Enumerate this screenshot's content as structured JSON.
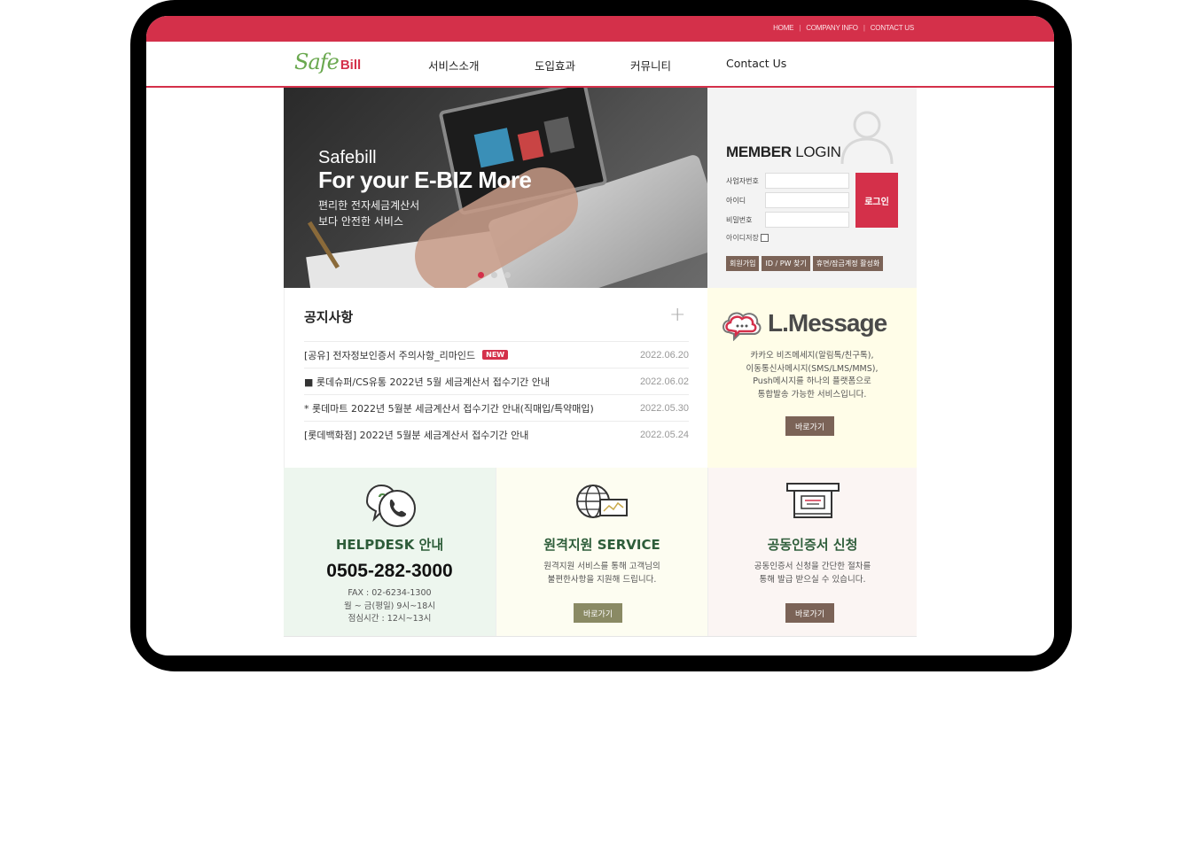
{
  "topbar": {
    "links": [
      "HOME",
      "COMPANY INFO",
      "CONTACT US"
    ]
  },
  "logo": {
    "safe": "Safe",
    "bill": "Bill"
  },
  "menu": [
    "서비스소개",
    "도입효과",
    "커뮤니티",
    "Contact Us"
  ],
  "hero": {
    "line1": "Safebill",
    "line2": "For your E-BIZ More",
    "line3": "편리한 전자세금계산서",
    "line4": "보다 안전한 서비스",
    "slides": 3,
    "active_slide": 1
  },
  "login": {
    "title_bold": "MEMBER",
    "title_rest": "LOGIN",
    "field1_label": "사업자번호",
    "field2_label": "아이디",
    "field3_label": "비밀번호",
    "login_button": "로그인",
    "save_label": "아이디저장",
    "links": [
      "회원가입",
      "ID / PW 찾기",
      "휴면/잠금계정 활성화"
    ]
  },
  "notice": {
    "title": "공지사항",
    "new_badge": "NEW",
    "items": [
      {
        "title": "[공유] 전자정보인증서 주의사항_리마인드",
        "date": "2022.06.20",
        "is_new": true
      },
      {
        "title": "■ 롯데슈퍼/CS유통 2022년 5월 세금계산서 접수기간 안내",
        "date": "2022.06.02"
      },
      {
        "title": "* 롯데마트 2022년 5월분 세금계산서 접수기간 안내(직매입/특약매입)",
        "date": "2022.05.30"
      },
      {
        "title": "[롯데백화점] 2022년 5월분 세금계산서 접수기간 안내",
        "date": "2022.05.24"
      }
    ]
  },
  "lmessage": {
    "logo_text": "L.Message",
    "desc1": "카카오 비즈메세지(알림톡/친구톡),",
    "desc2": "이동통신사메시지(SMS/LMS/MMS),",
    "desc3": "Push메시지를 하나의 플랫폼으로",
    "desc4": "통합발송 가능한 서비스입니다.",
    "button": "바로가기"
  },
  "helpdesk": {
    "title": "HELPDESK 안내",
    "phone": "0505-282-3000",
    "fax": "FAX : 02-6234-1300",
    "hours": "월 ~ 금(평일) 9시~18시",
    "lunch": "점심시간 : 12시~13시"
  },
  "remote": {
    "title": "원격지원 SERVICE",
    "desc1": "원격지원 서비스를 통해 고객님의",
    "desc2": "불편한사항을 지원해 드립니다.",
    "button": "바로가기"
  },
  "cert": {
    "title": "공동인증서 신청",
    "desc1": "공동인증서 신청을 간단한 절차를",
    "desc2": "통해 발급 받으실 수 있습니다.",
    "button": "바로가기"
  },
  "colors": {
    "brand_red": "#d4304a",
    "brand_green": "#6aa84f",
    "button_brown": "#7b6357",
    "button_olive": "#8a8a64"
  }
}
